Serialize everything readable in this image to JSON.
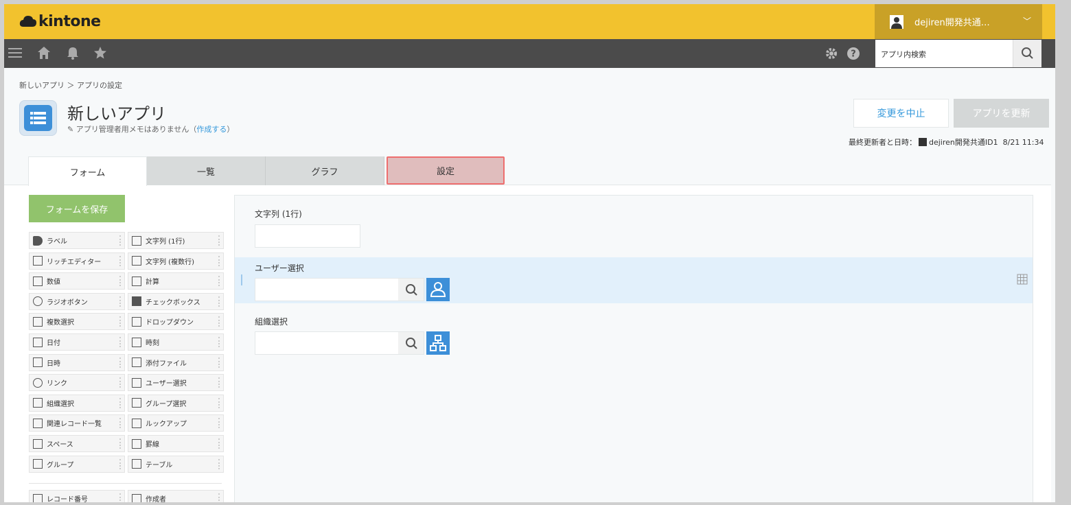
{
  "header": {
    "logo_text": "kintone",
    "user_name": "dejiren開発共通…",
    "search_placeholder": "アプリ内検索"
  },
  "breadcrumb": "新しいアプリ ＞ アプリの設定",
  "app": {
    "title": "新しいアプリ",
    "memo_text": "アプリ管理者用メモはありません（",
    "memo_link": "作成する",
    "memo_end": "）",
    "cancel_label": "変更を中止",
    "update_label": "アプリを更新",
    "lastmod_label": "最終更新者と日時：",
    "lastmod_user": "dejiren開発共通ID1",
    "lastmod_time": "8/21 11:34"
  },
  "tabs": [
    "フォーム",
    "一覧",
    "グラフ",
    "設定"
  ],
  "save_form_label": "フォームを保存",
  "palette": [
    [
      "ラベル",
      "文字列 (1行)"
    ],
    [
      "リッチエディター",
      "文字列 (複数行)"
    ],
    [
      "数値",
      "計算"
    ],
    [
      "ラジオボタン",
      "チェックボックス"
    ],
    [
      "複数選択",
      "ドロップダウン"
    ],
    [
      "日付",
      "時刻"
    ],
    [
      "日時",
      "添付ファイル"
    ],
    [
      "リンク",
      "ユーザー選択"
    ],
    [
      "組織選択",
      "グループ選択"
    ],
    [
      "関連レコード一覧",
      "ルックアップ"
    ],
    [
      "スペース",
      "罫線"
    ],
    [
      "グループ",
      "テーブル"
    ]
  ],
  "palette_extra": [
    "レコード番号",
    "作成者"
  ],
  "fields": {
    "text1_label": "文字列 (1行)",
    "user_label": "ユーザー選択",
    "org_label": "組織選択"
  },
  "colors": {
    "topbar": "#f2c22e",
    "navbar": "#4b4b4b",
    "accent": "#3498db",
    "save": "#91c36c",
    "highlight_border": "#ee6e6e"
  }
}
